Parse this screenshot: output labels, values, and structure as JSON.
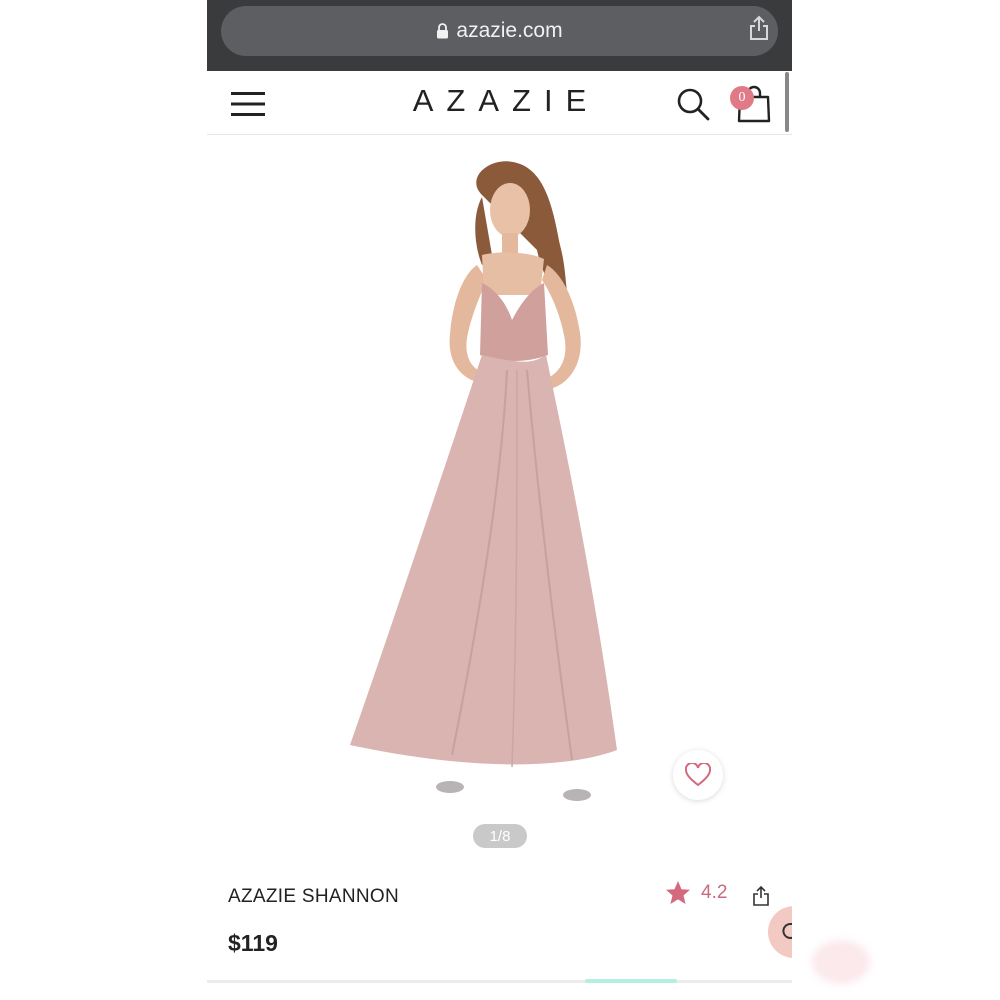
{
  "browser": {
    "url": "azazie.com"
  },
  "header": {
    "logo": "AZAZIE",
    "cart_count": "0"
  },
  "gallery": {
    "pager": "1/8"
  },
  "product": {
    "name": "AZAZIE SHANNON",
    "rating": "4.2",
    "price": "$119"
  },
  "colors": {
    "accent_pink": "#e07a86",
    "rating_pink": "#c86b7d",
    "dress": "#d9b4b0"
  },
  "icons": [
    "lock-icon",
    "share-icon",
    "menu-icon",
    "search-icon",
    "shopping-bag-icon",
    "heart-icon",
    "star-icon",
    "chat-icon"
  ]
}
